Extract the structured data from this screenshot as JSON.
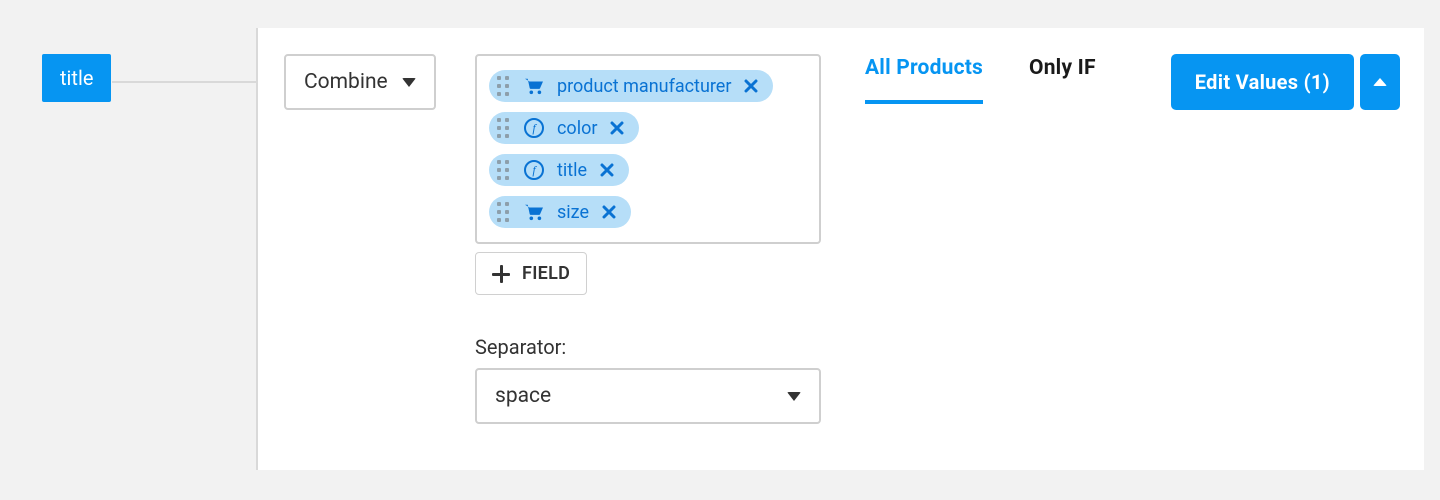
{
  "field_tag": "title",
  "operation": {
    "label": "Combine"
  },
  "fields": [
    {
      "icon": "cart",
      "label": "product manufacturer"
    },
    {
      "icon": "fx",
      "label": "color"
    },
    {
      "icon": "fx",
      "label": "title"
    },
    {
      "icon": "cart",
      "label": "size"
    }
  ],
  "add_field_label": "FIELD",
  "separator": {
    "label": "Separator:",
    "value": "space"
  },
  "tabs": {
    "all": "All Products",
    "only_if": "Only IF"
  },
  "buttons": {
    "edit_values": "Edit Values (1)"
  }
}
